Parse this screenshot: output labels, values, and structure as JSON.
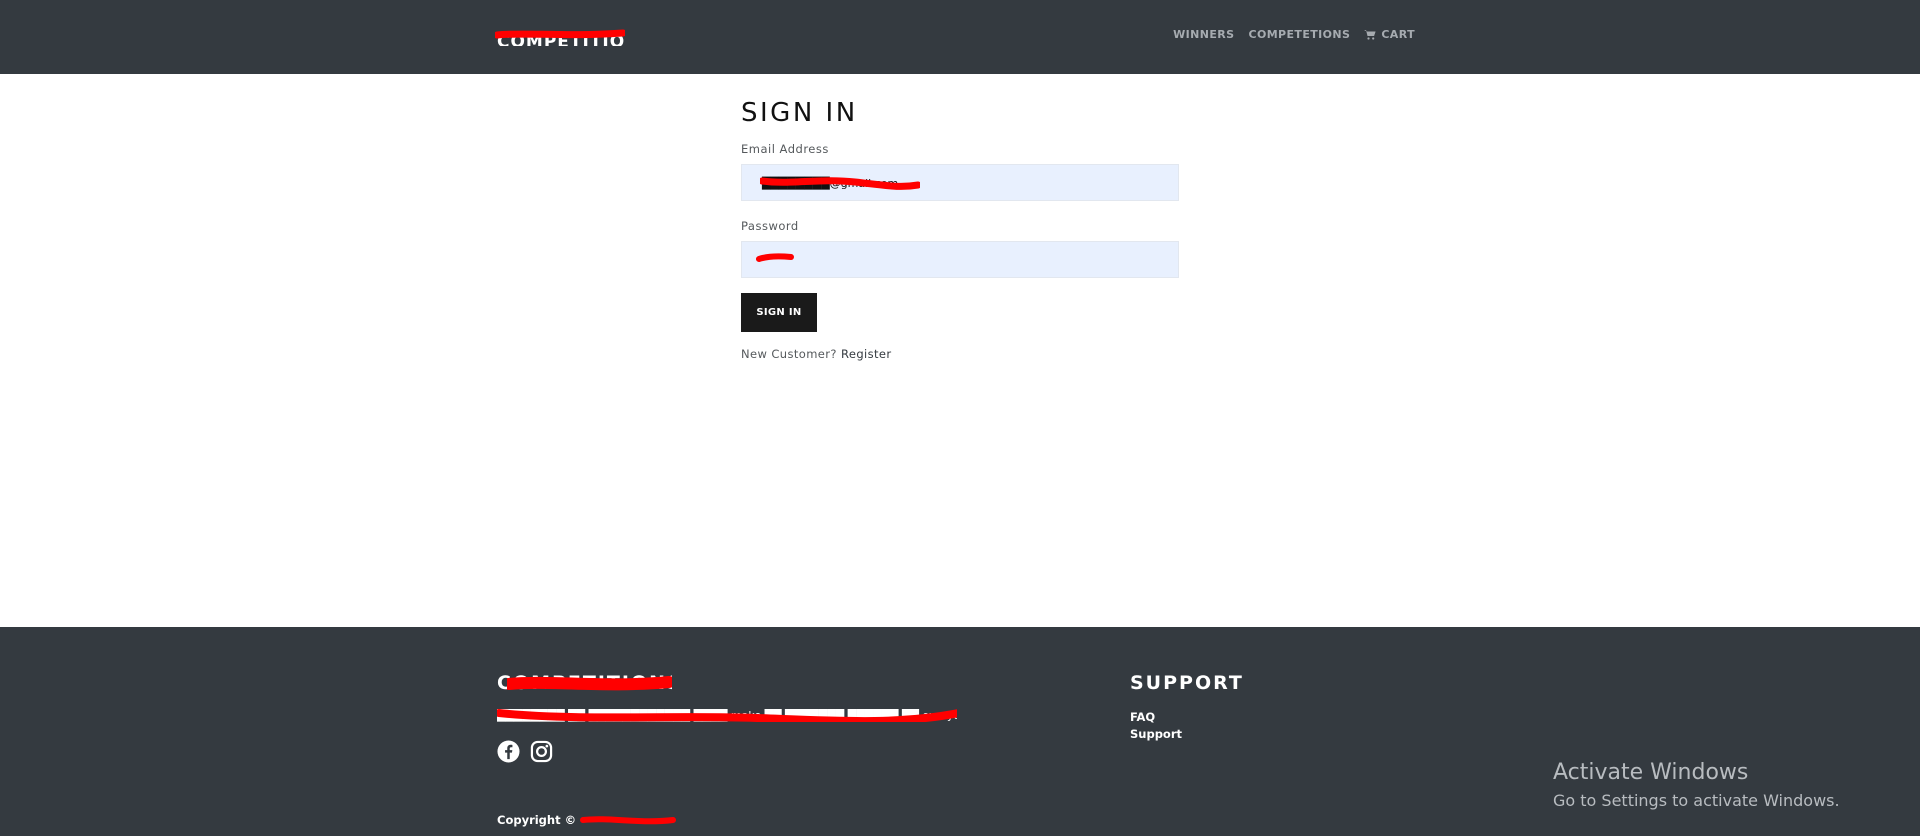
{
  "navbar": {
    "brand": "COMPETITIONS",
    "links": [
      {
        "label": "WINNERS"
      },
      {
        "label": "COMPETETIONS"
      },
      {
        "label": "CART",
        "icon": "cart-icon"
      }
    ]
  },
  "signin": {
    "title": "SIGN IN",
    "email_label": "Email Address",
    "email_value": "████████@gmail.com",
    "password_label": "Password",
    "password_value": "••",
    "submit_label": "SIGN IN",
    "new_customer_text": "New Customer?",
    "register_label": "Register"
  },
  "footer": {
    "brand": "COMPETITIONS",
    "tagline": "████████ ██ ████████████ ████ make ██ ███████ ██████ ██ everyone",
    "social": [
      {
        "icon": "facebook-icon"
      },
      {
        "icon": "instagram-icon"
      }
    ],
    "copyright": "Copyright ©",
    "support_title": "SUPPORT",
    "support_links": [
      "FAQ",
      "Support"
    ]
  },
  "os_watermark": {
    "title": "Activate Windows",
    "subtitle": "Go to Settings to activate Windows."
  },
  "colors": {
    "navbar_bg": "#343a40",
    "input_bg": "#e8f0fe",
    "button_bg": "#1a1a1a",
    "redaction": "#ff0000"
  }
}
